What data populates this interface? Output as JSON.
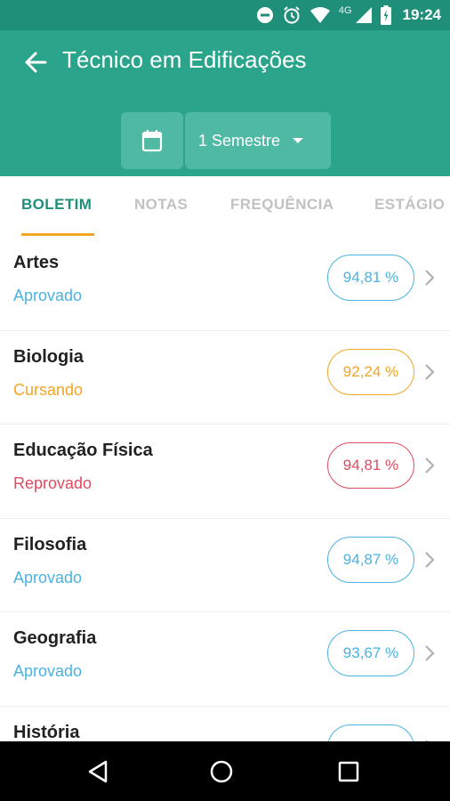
{
  "status_bar": {
    "time": "19:24",
    "network": "4G",
    "icons": [
      "dnd-icon",
      "alarm-icon",
      "wifi-icon",
      "signal-icon",
      "battery-icon"
    ]
  },
  "app_bar": {
    "title": "Técnico em Edificações",
    "semester_label": "1 Semestre",
    "background": "#2aa58c",
    "button_background": "#4fb9a4"
  },
  "tabs": [
    {
      "label": "BOLETIM",
      "active": true
    },
    {
      "label": "NOTAS",
      "active": false
    },
    {
      "label": "FREQUÊNCIA",
      "active": false
    },
    {
      "label": "ESTÁGIO",
      "active": false
    }
  ],
  "colors": {
    "accent": "#1f8f7a",
    "indicator": "#f2a626",
    "aprovado": "#4ab3e0",
    "cursando": "#f2a626",
    "reprovado": "#e04a5f"
  },
  "subjects": [
    {
      "name": "Artes",
      "status": "Aprovado",
      "status_type": "aprovado",
      "attendance": "94,81 %"
    },
    {
      "name": "Biologia",
      "status": "Cursando",
      "status_type": "cursando",
      "attendance": "92,24 %"
    },
    {
      "name": "Educação Física",
      "status": "Reprovado",
      "status_type": "reprovado",
      "attendance": "94,81 %"
    },
    {
      "name": "Filosofia",
      "status": "Aprovado",
      "status_type": "aprovado",
      "attendance": "94,87 %"
    },
    {
      "name": "Geografia",
      "status": "Aprovado",
      "status_type": "aprovado",
      "attendance": "93,67 %"
    },
    {
      "name": "História",
      "status": "",
      "status_type": "aprovado",
      "attendance": ""
    }
  ]
}
